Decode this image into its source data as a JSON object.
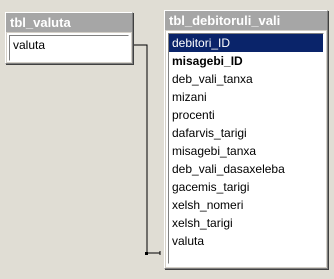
{
  "tables": [
    {
      "title": "tbl_valuta",
      "fields": [
        {
          "name": "valuta"
        }
      ]
    },
    {
      "title": "tbl_debitoruli_vali",
      "fields": [
        {
          "name": "debitori_ID"
        },
        {
          "name": "misagebi_ID"
        },
        {
          "name": "deb_vali_tanxa"
        },
        {
          "name": "mizani"
        },
        {
          "name": "procenti"
        },
        {
          "name": "dafarvis_tarigi"
        },
        {
          "name": "misagebi_tanxa"
        },
        {
          "name": "deb_vali_dasaxeleba"
        },
        {
          "name": "gacemis_tarigi"
        },
        {
          "name": "xelsh_nomeri"
        },
        {
          "name": "xelsh_tarigi"
        },
        {
          "name": "valuta"
        }
      ]
    }
  ]
}
